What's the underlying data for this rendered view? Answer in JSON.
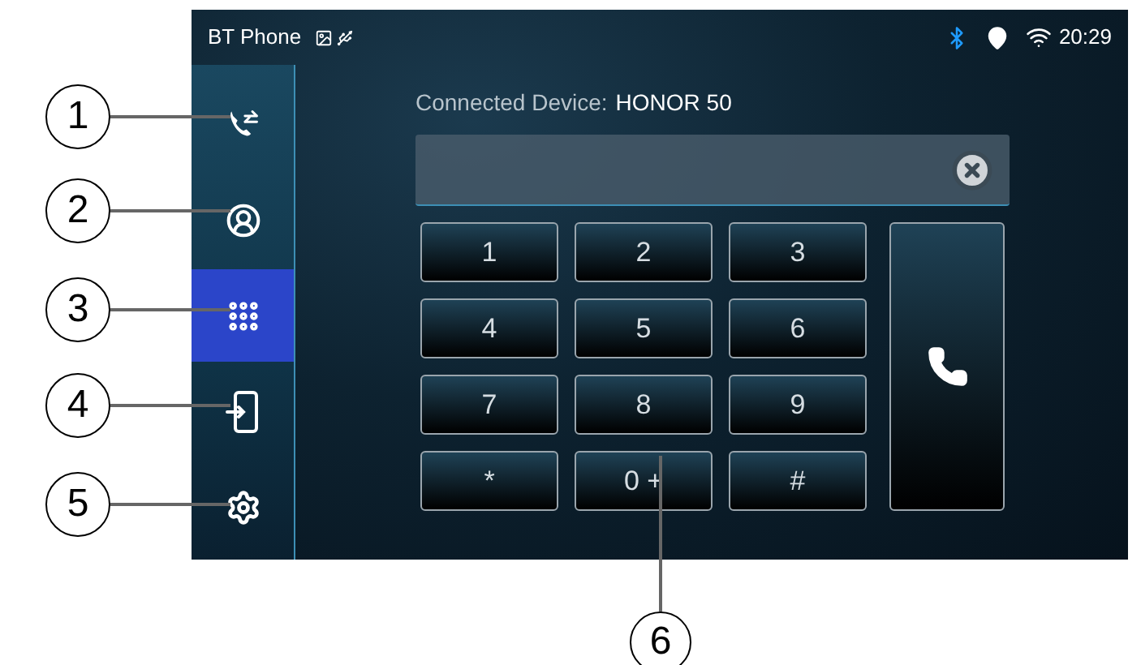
{
  "status_bar": {
    "title": "BT Phone",
    "time": "20:29"
  },
  "sidebar": {
    "items": [
      {
        "kind": "call-log",
        "selected": false
      },
      {
        "kind": "contacts",
        "selected": false
      },
      {
        "kind": "dialpad",
        "selected": true
      },
      {
        "kind": "device",
        "selected": false
      },
      {
        "kind": "settings",
        "selected": false
      }
    ]
  },
  "connection": {
    "label": "Connected Device:",
    "device": "HONOR 50"
  },
  "keypad": {
    "keys": [
      "1",
      "2",
      "3",
      "4",
      "5",
      "6",
      "7",
      "8",
      "9",
      "*",
      "0 +",
      "#"
    ]
  },
  "callouts": [
    "1",
    "2",
    "3",
    "4",
    "5",
    "6"
  ]
}
